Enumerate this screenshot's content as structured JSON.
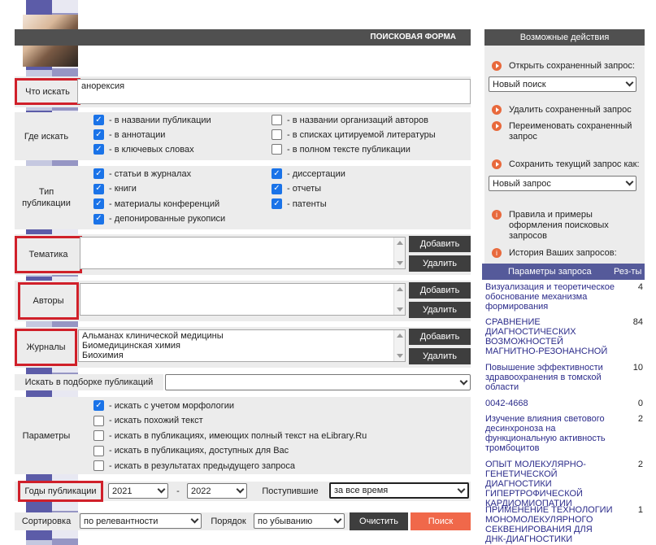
{
  "form": {
    "header": "ПОИСКОВАЯ ФОРМА",
    "what_label": "Что искать",
    "what_value": "анорексия",
    "where_label": "Где искать",
    "where_options": [
      {
        "label": "- в названии публикации",
        "checked": true
      },
      {
        "label": "- в аннотации",
        "checked": true
      },
      {
        "label": "- в ключевых словах",
        "checked": true
      },
      {
        "label": "- в названии организаций авторов",
        "checked": false
      },
      {
        "label": "- в списках цитируемой литературы",
        "checked": false
      },
      {
        "label": "- в полном тексте публикации",
        "checked": false
      }
    ],
    "type_label": "Тип публикации",
    "type_options": [
      {
        "label": "- статьи в журналах",
        "checked": true
      },
      {
        "label": "- книги",
        "checked": true
      },
      {
        "label": "- материалы конференций",
        "checked": true
      },
      {
        "label": "- депонированные рукописи",
        "checked": true
      },
      {
        "label": "- диссертации",
        "checked": true
      },
      {
        "label": "- отчеты",
        "checked": true
      },
      {
        "label": "- патенты",
        "checked": true
      }
    ],
    "topic_label": "Тематика",
    "authors_label": "Авторы",
    "journals_label": "Журналы",
    "journals_list": [
      "Альманах клинической медицины",
      "Биомедицинская химия",
      "Биохимия"
    ],
    "add_label": "Добавить",
    "delete_label": "Удалить",
    "collection_label": "Искать в подборке публикаций",
    "collection_value": "",
    "params_label": "Параметры",
    "params_options": [
      {
        "label": "- искать с учетом морфологии",
        "checked": true
      },
      {
        "label": "- искать похожий текст",
        "checked": false
      },
      {
        "label": "- искать в публикациях, имеющих полный текст на eLibrary.Ru",
        "checked": false
      },
      {
        "label": "- искать в публикациях, доступных для Вас",
        "checked": false
      },
      {
        "label": "- искать в результатах предыдущего запроса",
        "checked": false
      }
    ],
    "years_label": "Годы публикации",
    "year_from": "2021",
    "year_dash": "-",
    "year_to": "2022",
    "received_label": "Поступившие",
    "received_value": "за все время",
    "sort_label": "Сортировка",
    "sort_value": "по релевантности",
    "order_label": "Порядок",
    "order_value": "по убыванию",
    "clear_label": "Очистить",
    "search_label": "Поиск"
  },
  "colors": {
    "accent": "#e8693c",
    "header": "#505050",
    "history_header": "#555a9a",
    "highlight": "#d0202a",
    "search_button": "#f0684a"
  },
  "right": {
    "header": "Возможные действия",
    "open_saved": "Открыть сохраненный запрос:",
    "saved_select": "Новый поиск",
    "delete_saved": "Удалить сохраненный запрос",
    "rename_saved": "Переименовать сохраненный запрос",
    "save_current": "Сохранить текущий запрос как:",
    "save_select": "Новый запрос",
    "rules": "Правила и примеры оформления поисковых запросов",
    "history": "История Ваших запросов:",
    "col_params": "Параметры запроса",
    "col_results": "Рез-ты",
    "history_rows": [
      {
        "q": "Визуализация и теоретическое обоснование механизма формирования",
        "n": "4"
      },
      {
        "q": "СРАВНЕНИЕ ДИАГНОСТИЧЕСКИХ ВОЗМОЖНОСТЕЙ МАГНИТНО-РЕЗОНАНСНОЙ",
        "n": "84"
      },
      {
        "q": "Повышение эффективности здравоохранения в томской области",
        "n": "10"
      },
      {
        "q": "0042-4668",
        "n": "0"
      },
      {
        "q": "Изучение влияния светового десинхроноза на функциональную активность тромбоцитов",
        "n": "2"
      },
      {
        "q": "ОПЫТ МОЛЕКУЛЯРНО-ГЕНЕТИЧЕСКОЙ ДИАГНОСТИКИ ГИПЕРТРОФИЧЕСКОЙ КАРДИОМИОПАТИИ",
        "n": "2"
      },
      {
        "q": "ПРИМЕНЕНИЕ ТЕХНОЛОГИИ МОНОМОЛЕКУЛЯРНОГО СЕКВЕНИРОВАНИЯ ДЛЯ ДНК-ДИАГНОСТИКИ",
        "n": "1"
      }
    ]
  }
}
